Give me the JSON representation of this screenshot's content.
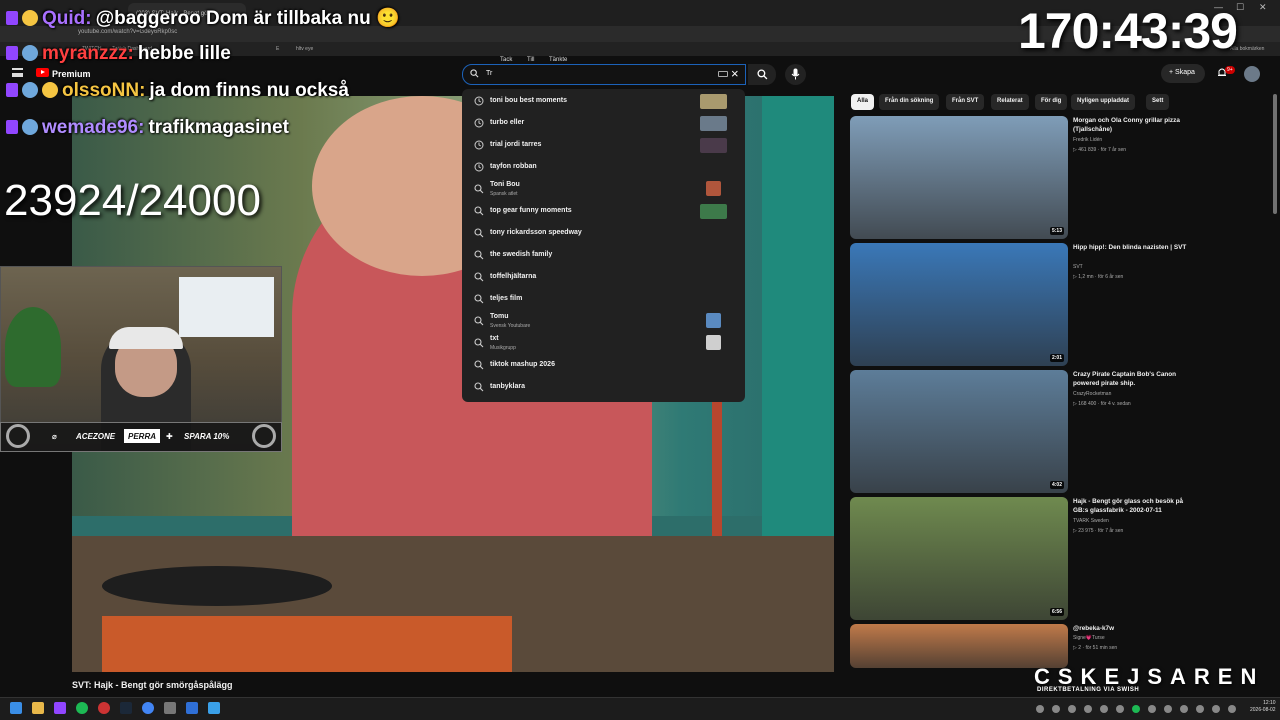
{
  "browser": {
    "tab_title": "(203) SVT: Hajk - Bengt gö",
    "url": "youtube.com/watch?v=Gdey6Rkp0sc",
    "bookmarks": [
      "TWITCH",
      "Twitch Dashboard",
      "E",
      "hltv eye"
    ],
    "right_bookmark": "Alla bokmärken"
  },
  "youtube": {
    "premium_label": "Premium",
    "search": {
      "value": "Tr",
      "hints": [
        "Tack",
        "Till",
        "Tänkte"
      ]
    },
    "create_label": "Skapa",
    "notification_count": "9+",
    "suggestions": [
      {
        "text": "toni bou best moments",
        "sub": "",
        "icon": "history-icon",
        "thumb": "wide",
        "thumb_color": "#a99a6e"
      },
      {
        "text": "turbo eller",
        "sub": "",
        "icon": "history-icon",
        "thumb": "wide",
        "thumb_color": "#6a7a8a"
      },
      {
        "text": "trial jordi tarres",
        "sub": "",
        "icon": "history-icon",
        "thumb": "wide",
        "thumb_color": "#4a3a4a"
      },
      {
        "text": "tayfon robban",
        "sub": "",
        "icon": "history-icon",
        "thumb": "",
        "thumb_color": ""
      },
      {
        "text": "Toni Bou",
        "sub": "Spansk atlet",
        "icon": "search-icon",
        "thumb": "square",
        "thumb_color": "#b0563c"
      },
      {
        "text": "top gear funny moments",
        "sub": "",
        "icon": "search-icon",
        "thumb": "wide",
        "thumb_color": "#3d7a4a"
      },
      {
        "text": "tony rickardsson speedway",
        "sub": "",
        "icon": "search-icon",
        "thumb": "",
        "thumb_color": ""
      },
      {
        "text": "the swedish family",
        "sub": "",
        "icon": "search-icon",
        "thumb": "",
        "thumb_color": ""
      },
      {
        "text": "toffelhjältarna",
        "sub": "",
        "icon": "search-icon",
        "thumb": "",
        "thumb_color": ""
      },
      {
        "text": "teljes film",
        "sub": "",
        "icon": "search-icon",
        "thumb": "",
        "thumb_color": ""
      },
      {
        "text": "Tomu",
        "sub": "Svensk Youtubare",
        "icon": "search-icon",
        "thumb": "square",
        "thumb_color": "#5a8ac0"
      },
      {
        "text": "txt",
        "sub": "Musikgrupp",
        "icon": "search-icon",
        "thumb": "square",
        "thumb_color": "#cfcfcf"
      },
      {
        "text": "tiktok mashup 2026",
        "sub": "",
        "icon": "search-icon",
        "thumb": "",
        "thumb_color": ""
      },
      {
        "text": "tanbyklara",
        "sub": "",
        "icon": "search-icon",
        "thumb": "",
        "thumb_color": ""
      }
    ],
    "chips": [
      "Alla",
      "Från din sökning",
      "Från SVT",
      "Relaterat",
      "För dig",
      "Nyligen uppladdat",
      "Sett"
    ],
    "recommendations": [
      {
        "title": "Morgan och Ola Conny grillar pizza (Tjallschåne)",
        "channel": "Fredrik Lidén",
        "meta": "▷ 461 839 · för 7 år sen",
        "duration": "5:13",
        "thumb_color": "#7f9db8"
      },
      {
        "title": "Hipp hipp!: Den blinda nazisten | SVT",
        "channel": "SVT",
        "meta": "▷ 1,2 mn · för 6 år sen",
        "duration": "2:01",
        "thumb_color": "#3a78b8"
      },
      {
        "title": "Crazy Pirate Captain Bob's Canon powered pirate ship.",
        "channel": "CrazyRocketman",
        "meta": "▷ 168 400 · för 4 v. sedan",
        "duration": "4:02",
        "thumb_color": "#5d7d99"
      },
      {
        "title": "Hajk - Bengt gör glass och besök på GB:s glassfabrik - 2002-07-11",
        "channel": "TVARK Sweden",
        "meta": "▷ 23 975 · för 7 år sen",
        "duration": "6:56",
        "thumb_color": "#6f8a4f"
      },
      {
        "title": "@rebeka-k7w",
        "channel": "Signe💗Turse",
        "meta": "▷ 2 · för 51 min sen",
        "duration": "",
        "thumb_color": "#c07a4a"
      }
    ],
    "video_title": "SVT: Hajk - Bengt gör smörgåspålägg"
  },
  "stream_overlay": {
    "timer": "170:43:39",
    "sub_counter": "23924/24000",
    "chat": [
      {
        "user": "Quid:",
        "message": "@baggeroo Dom är tillbaka nu 🙂",
        "user_color": "#a970ff"
      },
      {
        "user": "myranzzz:",
        "message": "hebbe lille",
        "user_color": "#ff4040"
      },
      {
        "user": "olssoNN:",
        "message": "ja dom finns nu också",
        "user_color": "#f5c542"
      },
      {
        "user": "wemade96:",
        "message": "trafikmagasinet",
        "user_color": "#b08cff"
      }
    ],
    "sponsor": {
      "brand": "ACEZONE",
      "code": "PERRA",
      "offer": "SPARA 10%"
    },
    "branding": "CSKEJSAREN",
    "branding_sub": "DIREKTBETALNING VIA SWISH"
  },
  "taskbar": {
    "time": "12:10",
    "date": "2026-08-02"
  }
}
